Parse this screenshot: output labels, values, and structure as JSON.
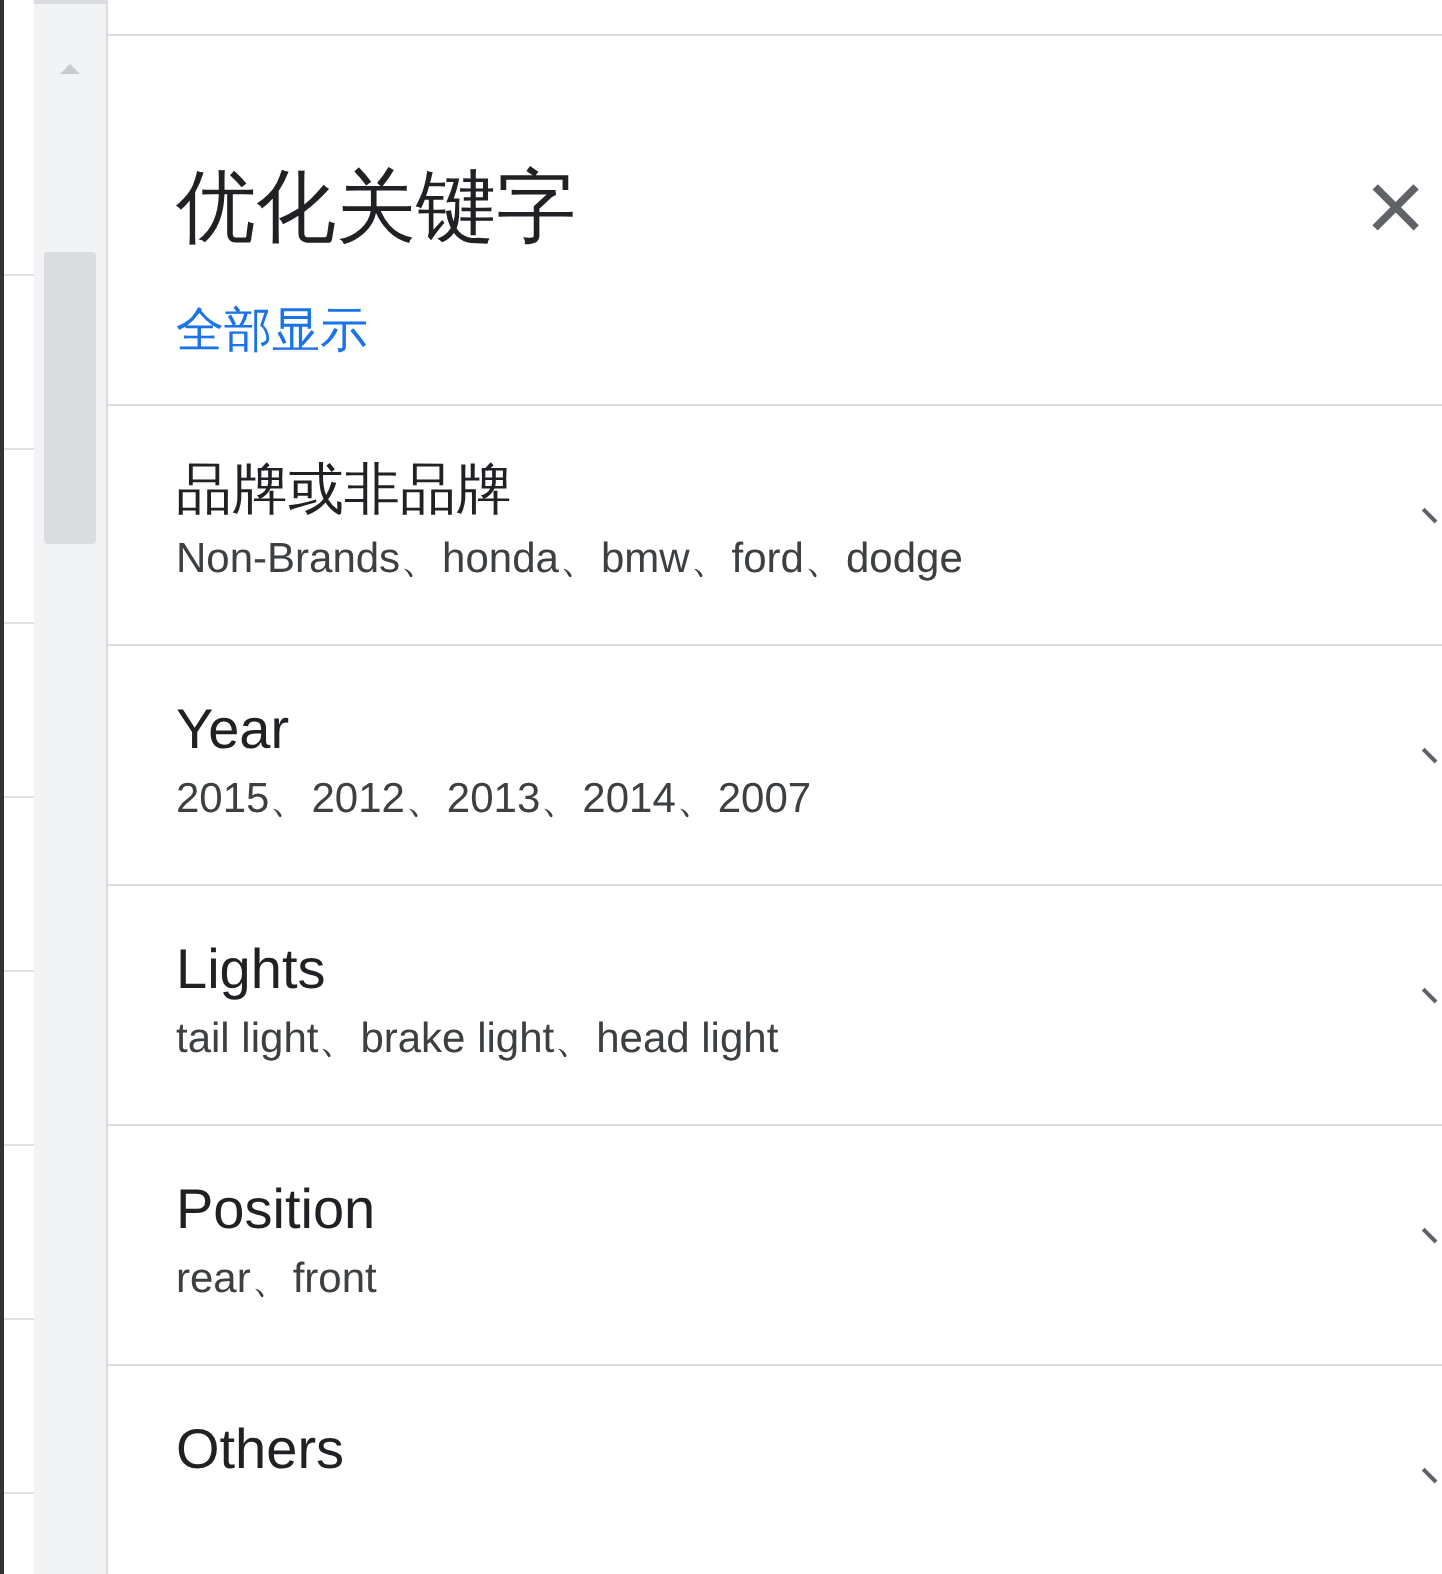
{
  "panel": {
    "title": "优化关键字",
    "close": "×",
    "show_all_link": "全部显示"
  },
  "items": [
    {
      "title": "品牌或非品牌",
      "values": "Non-Brands、honda、bmw、ford、dodge"
    },
    {
      "title": "Year",
      "values": "2015、2012、2013、2014、2007"
    },
    {
      "title": "Lights",
      "values": "tail light、brake light、head light"
    },
    {
      "title": "Position",
      "values": "rear、front"
    },
    {
      "title": "Others"
    }
  ]
}
